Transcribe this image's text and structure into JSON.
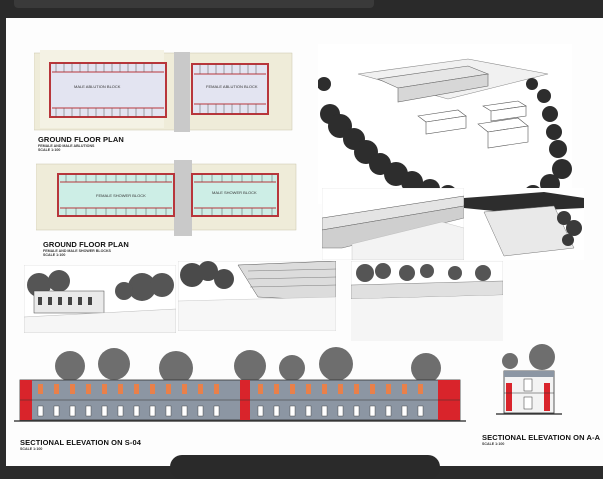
{
  "sheet": {
    "plan_top": {
      "title": "GROUND FLOOR PLAN",
      "subtitle": "FEMALE AND MALE ABLUTIONS",
      "scale": "SCALE 1:100",
      "room_left_label": "MALE ABLUTION BLOCK",
      "room_right_label": "FEMALE ABLUTION BLOCK"
    },
    "plan_bottom": {
      "title": "GROUND FLOOR PLAN",
      "subtitle": "FEMALE AND MALE SHOWER BLOCKS",
      "scale": "SCALE 1:100",
      "room_left_label": "FEMALE SHOWER BLOCK",
      "room_right_label": "MALE SHOWER BLOCK"
    },
    "elevation_long": {
      "title": "SECTIONAL  ELEVATION ON S-04",
      "scale": "SCALE 1:100"
    },
    "elevation_section": {
      "title": "SECTIONAL ELEVATION ON A-A",
      "scale": "SCALE 1:100"
    }
  },
  "colors": {
    "wall_red": "#b8363b",
    "plan_lavender": "#e3e4f1",
    "plan_teal": "#cdeee6",
    "site_beige": "#efecd9",
    "facade_grey": "#8c96a3",
    "accent_red": "#d9242b",
    "window_orange": "#e9804a"
  },
  "icons": [
    "tree-icon",
    "building-icon"
  ]
}
